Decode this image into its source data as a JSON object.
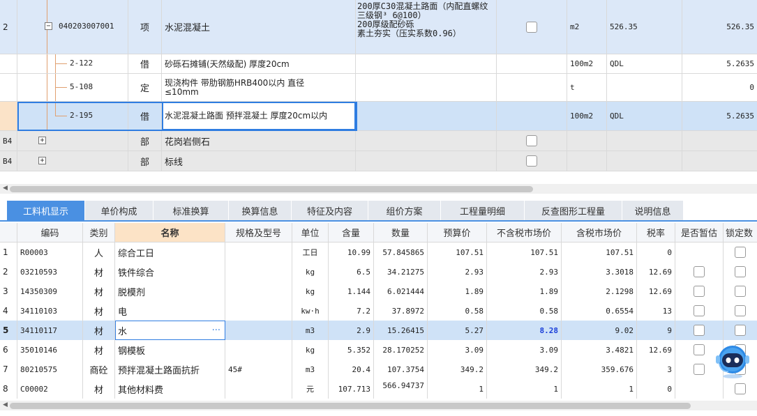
{
  "upper": {
    "rows": [
      {
        "no": "2",
        "code": "040203007001",
        "type": "项",
        "name": "水泥混凝土",
        "feature": "200厚C30混凝土路面（内配直螺纹三级钢³ 6@100）\n200厚级配砂砾\n素土夯实（压实系数0.96）",
        "checked": false,
        "unit": "m2",
        "expr": "526.35",
        "qty": "526.35",
        "expander": "−"
      },
      {
        "no": "",
        "code": "2-122",
        "type": "借",
        "name": "砂砾石摊铺(天然级配) 厚度20cm",
        "feature": "",
        "unit": "100m2",
        "expr": "QDL",
        "qty": "5.2635"
      },
      {
        "no": "",
        "code": "5-108",
        "type": "定",
        "name": "现浇构件 带肋钢筋HRB400以内 直径≤10mm",
        "feature": "",
        "unit": "t",
        "expr": "",
        "qty": "0"
      },
      {
        "no": "",
        "code": "2-195",
        "type": "借",
        "name": "水泥混凝土路面 预拌混凝土 厚度20cm以内",
        "feature": "",
        "unit": "100m2",
        "expr": "QDL",
        "qty": "5.2635"
      },
      {
        "no": "B4",
        "code": "",
        "type": "部",
        "name": "花岗岩侧石",
        "feature": "",
        "checked": false,
        "unit": "",
        "expr": "",
        "qty": "",
        "expander": "+"
      },
      {
        "no": "B4",
        "code": "",
        "type": "部",
        "name": "标线",
        "feature": "",
        "checked": false,
        "unit": "",
        "expr": "",
        "qty": "",
        "expander": "+"
      }
    ]
  },
  "tabs": [
    "工料机显示",
    "单价构成",
    "标准换算",
    "换算信息",
    "特征及内容",
    "组价方案",
    "工程量明细",
    "反查图形工程量",
    "说明信息"
  ],
  "lower": {
    "headers": [
      "",
      "编码",
      "类别",
      "名称",
      "规格及型号",
      "单位",
      "含量",
      "数量",
      "预算价",
      "不含税市场价",
      "含税市场价",
      "税率",
      "是否暂估",
      "锁定数"
    ],
    "rows": [
      {
        "no": "1",
        "code": "R00003",
        "cat": "人",
        "name": "综合工日",
        "spec": "",
        "unit": "工日",
        "content": "10.99",
        "qty": "57.845865",
        "budget": "107.51",
        "market": "107.51",
        "market_tax": "107.51",
        "rate": "0",
        "est": null,
        "lock": true
      },
      {
        "no": "2",
        "code": "03210593",
        "cat": "材",
        "name": "铁件综合",
        "spec": "",
        "unit": "kg",
        "content": "6.5",
        "qty": "34.21275",
        "budget": "2.93",
        "market": "2.93",
        "market_tax": "3.3018",
        "rate": "12.69",
        "est": false,
        "lock": true
      },
      {
        "no": "3",
        "code": "14350309",
        "cat": "材",
        "name": "脱模剂",
        "spec": "",
        "unit": "kg",
        "content": "1.144",
        "qty": "6.021444",
        "budget": "1.89",
        "market": "1.89",
        "market_tax": "2.1298",
        "rate": "12.69",
        "est": false,
        "lock": true
      },
      {
        "no": "4",
        "code": "34110103",
        "cat": "材",
        "name": "电",
        "spec": "",
        "unit": "kw·h",
        "content": "7.2",
        "qty": "37.8972",
        "budget": "0.58",
        "market": "0.58",
        "market_tax": "0.6554",
        "rate": "13",
        "est": false,
        "lock": true
      },
      {
        "no": "5",
        "code": "34110117",
        "cat": "材",
        "name": "水",
        "spec": "",
        "unit": "m3",
        "content": "2.9",
        "qty": "15.26415",
        "budget": "5.27",
        "market": "8.28",
        "market_tax": "9.02",
        "rate": "9",
        "est": false,
        "lock": true
      },
      {
        "no": "6",
        "code": "35010146",
        "cat": "材",
        "name": "钢模板",
        "spec": "",
        "unit": "kg",
        "content": "5.352",
        "qty": "28.170252",
        "budget": "3.09",
        "market": "3.09",
        "market_tax": "3.4821",
        "rate": "12.69",
        "est": false,
        "lock": true
      },
      {
        "no": "7",
        "code": "80210575",
        "cat": "商砼",
        "name": "预拌混凝土路面抗折",
        "spec": "45#",
        "unit": "m3",
        "content": "20.4",
        "qty": "107.3754",
        "budget": "349.2",
        "market": "349.2",
        "market_tax": "359.676",
        "rate": "3",
        "est": false,
        "lock": true
      },
      {
        "no": "8",
        "code": "C00002",
        "cat": "材",
        "name": "其他材料费",
        "spec": "",
        "unit": "元",
        "content": "107.713",
        "qty": "566.94737",
        "budget": "1",
        "market": "1",
        "market_tax": "1",
        "rate": "0",
        "est": null,
        "lock": true
      }
    ],
    "ellipsis": "···"
  },
  "colors": {
    "accent": "#4a90e2",
    "selected_row": "#cfe2f7",
    "group_row": "#dce8f8",
    "part_row": "#e8e8e8",
    "highlight_value": "#1a3fd9"
  }
}
